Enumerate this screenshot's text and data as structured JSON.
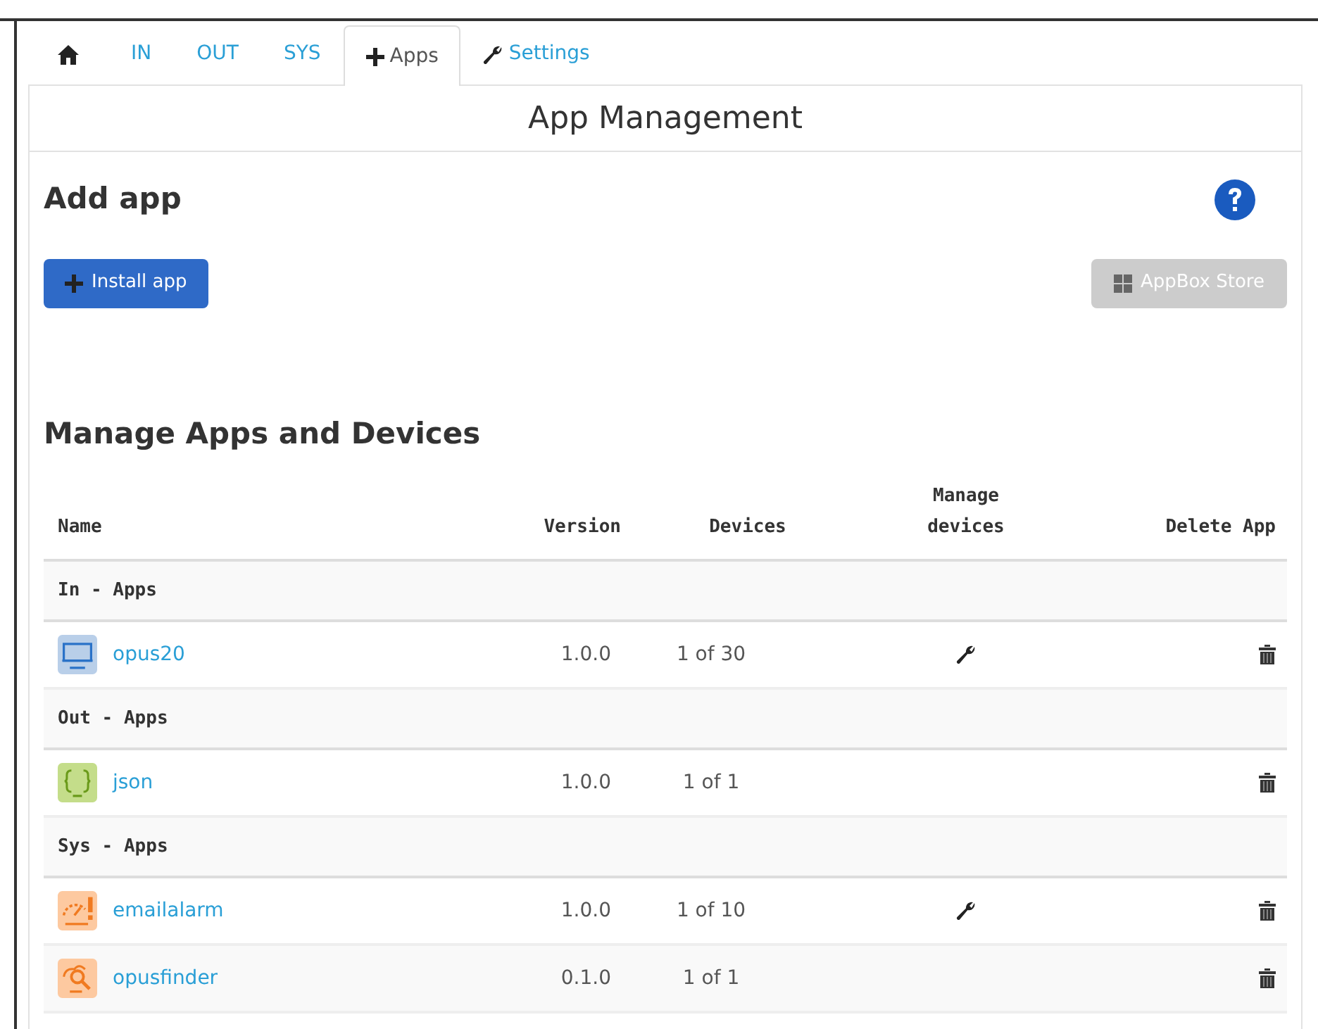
{
  "tabs": [
    {
      "kind": "home",
      "selected": false
    },
    {
      "kind": "text",
      "label": "IN",
      "selected": false
    },
    {
      "kind": "text",
      "label": "OUT",
      "selected": false
    },
    {
      "kind": "text",
      "label": "SYS",
      "selected": false
    },
    {
      "kind": "plus",
      "label": "Apps",
      "selected": true
    },
    {
      "kind": "wrench",
      "label": "Settings",
      "selected": false
    }
  ],
  "panel": {
    "title": "App Management"
  },
  "add_app": {
    "heading": "Add app",
    "install_button": "Install app",
    "store_button": {
      "label": "AppBox Store",
      "disabled": true
    }
  },
  "manage": {
    "heading": "Manage Apps and Devices",
    "columns": [
      "Name",
      "Version",
      "Devices",
      "Manage devices",
      "Delete App"
    ],
    "groups": [
      {
        "title": "In - Apps",
        "apps": [
          {
            "kind": "monitor",
            "name": "opus20",
            "version": "1.0.0",
            "devices": "1 of 30",
            "manageable": true
          }
        ]
      },
      {
        "title": "Out - Apps",
        "apps": [
          {
            "kind": "braces",
            "name": "json",
            "version": "1.0.0",
            "devices": "1 of 1",
            "manageable": false
          }
        ]
      },
      {
        "title": "Sys - Apps",
        "apps": [
          {
            "kind": "alarm",
            "name": "emailalarm",
            "version": "1.0.0",
            "devices": "1 of 10",
            "manageable": true
          },
          {
            "kind": "search",
            "name": "opusfinder",
            "version": "0.1.0",
            "devices": "1 of 1",
            "manageable": false
          }
        ]
      }
    ]
  }
}
